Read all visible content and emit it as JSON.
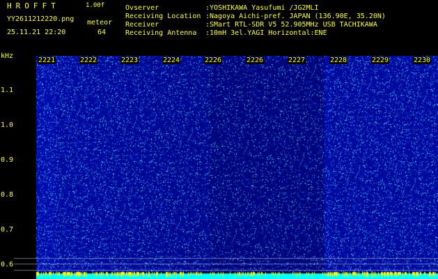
{
  "header": {
    "title": "HROFFT",
    "version": "1.00f",
    "filename": "YY2611212220.png",
    "meteor_label": "meteor",
    "datetime": "25.11.21 22:20",
    "meteor_count": "64"
  },
  "info": [
    {
      "key": "Ovserver",
      "value": ":YOSHIKAWA Yasufumi /JG2MLI"
    },
    {
      "key": "Receiving Location",
      "value": ":Nagoya Aichi-pref. JAPAN (136.90E, 35.20N)"
    },
    {
      "key": "Receiver",
      "value": ":SMart RTL-SDR V5 52.905MHz USB TACHIKAWA"
    },
    {
      "key": "Receiving Antenna",
      "value": ":10mH 3el.YAGI Horizontal:ENE"
    }
  ],
  "axis": {
    "unit": "kHz",
    "y_ticks": [
      "1.1",
      "1.0",
      "0.9",
      "0.8",
      "0.7",
      "0.6"
    ],
    "x_ticks": [
      "2221",
      "2222",
      "2223",
      "2224",
      "2226",
      "2226",
      "2227",
      "2228",
      "2229",
      "2230"
    ]
  },
  "colors": {
    "background": "#000000",
    "label": "#ffff33",
    "noise_floor": "#0a1f8a",
    "meteor_marker": "#ffff00",
    "baseline": "#00ffff"
  }
}
